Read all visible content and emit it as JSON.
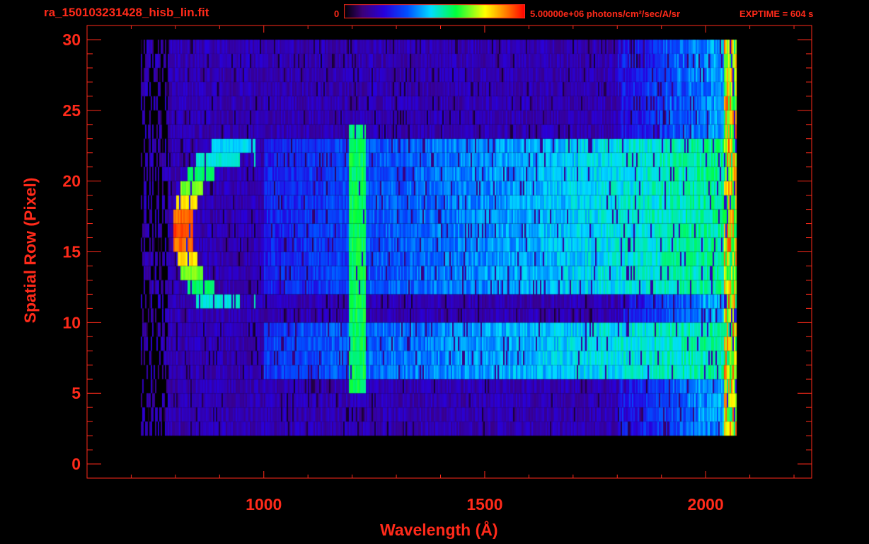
{
  "header": {
    "filename": "ra_150103231428_hisb_lin.fit",
    "colorbar_min": "0",
    "colorbar_max_label": "5.00000e+06 photons/cm²/sec/A/sr",
    "exptime": "EXPTIME = 604 s"
  },
  "chart_data": {
    "type": "heatmap",
    "title": "ra_150103231428_hisb_lin.fit",
    "xlabel": "Wavelength (Å)",
    "ylabel": "Spatial Row (Pixel)",
    "xlim": [
      600,
      2240
    ],
    "ylim": [
      -1,
      31
    ],
    "xticks": [
      1000,
      1500,
      2000
    ],
    "yticks": [
      0,
      5,
      10,
      15,
      20,
      25,
      30
    ],
    "grid": false,
    "colorscale": "rainbow (black-purple-blue-cyan-green-yellow-red)",
    "colorbar_range": [
      0,
      5000000
    ],
    "units": "photons/cm²/sec/A/sr",
    "exptime_s": 604,
    "data_extent": {
      "wavelength": [
        780,
        2070
      ],
      "rows": [
        2,
        30
      ]
    },
    "features": [
      {
        "name": "arc",
        "wavelength": [
          790,
          960
        ],
        "rows": [
          11,
          24
        ],
        "peak_row": 16,
        "peak_level": 0.95
      },
      {
        "name": "vertical line",
        "wavelength": [
          1190,
          1230
        ],
        "rows": [
          5,
          24
        ],
        "level": 0.55
      },
      {
        "name": "band",
        "wavelength": [
          1000,
          2060
        ],
        "rows": [
          6,
          10
        ],
        "level": 0.45
      },
      {
        "name": "band",
        "wavelength": [
          1000,
          2060
        ],
        "rows": [
          12,
          23
        ],
        "level": 0.3
      }
    ]
  },
  "colors": {
    "text": "#ff2a1a",
    "axes": "#ff2a1a",
    "background": "#000000"
  }
}
